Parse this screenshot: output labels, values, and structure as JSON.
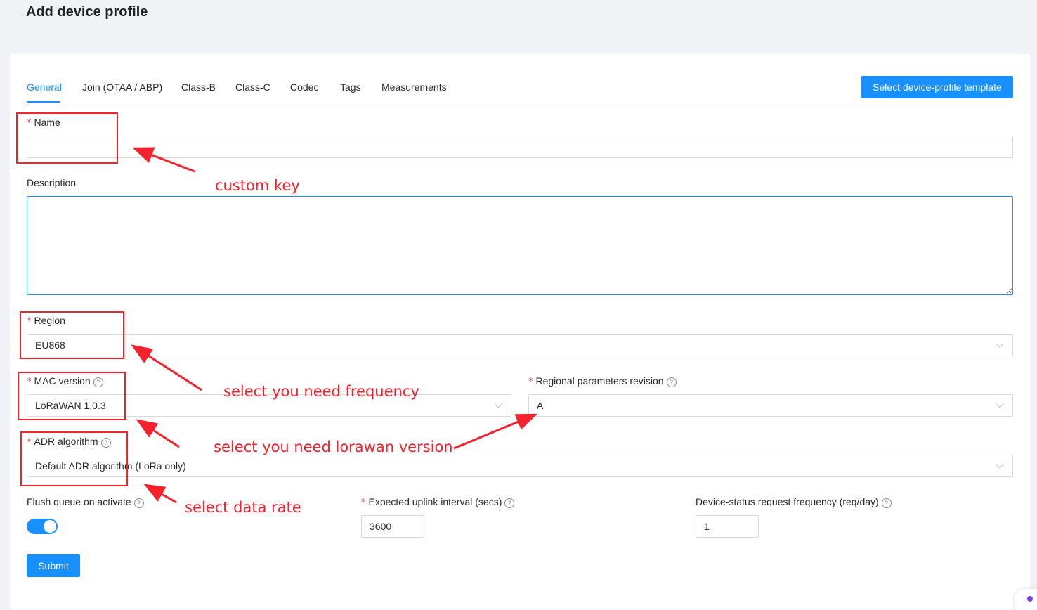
{
  "page": {
    "title": "Add device profile"
  },
  "tabs": [
    "General",
    "Join (OTAA / ABP)",
    "Class-B",
    "Class-C",
    "Codec",
    "Tags",
    "Measurements"
  ],
  "template_button": "Select device-profile template",
  "form": {
    "required_mark": "*",
    "help_mark": "?",
    "name": {
      "label": "Name",
      "value": ""
    },
    "description": {
      "label": "Description",
      "value": ""
    },
    "region": {
      "label": "Region",
      "value": "EU868"
    },
    "mac_version": {
      "label": "MAC version",
      "value": "LoRaWAN 1.0.3"
    },
    "regional_params": {
      "label": "Regional parameters revision",
      "value": "A"
    },
    "adr": {
      "label": "ADR algorithm",
      "value": "Default ADR algorithm (LoRa only)"
    },
    "flush_queue": {
      "label": "Flush queue on activate",
      "enabled": true
    },
    "uplink_interval": {
      "label": "Expected uplink interval (secs)",
      "value": "3600"
    },
    "status_freq": {
      "label": "Device-status request frequency (req/day)",
      "value": "1"
    },
    "submit": "Submit"
  },
  "annotations": {
    "color": "#f5222d",
    "custom_key": "custom key",
    "frequency": "select you need frequency",
    "lorawan_version": "select you need lorawan version",
    "data_rate": "select data rate"
  }
}
